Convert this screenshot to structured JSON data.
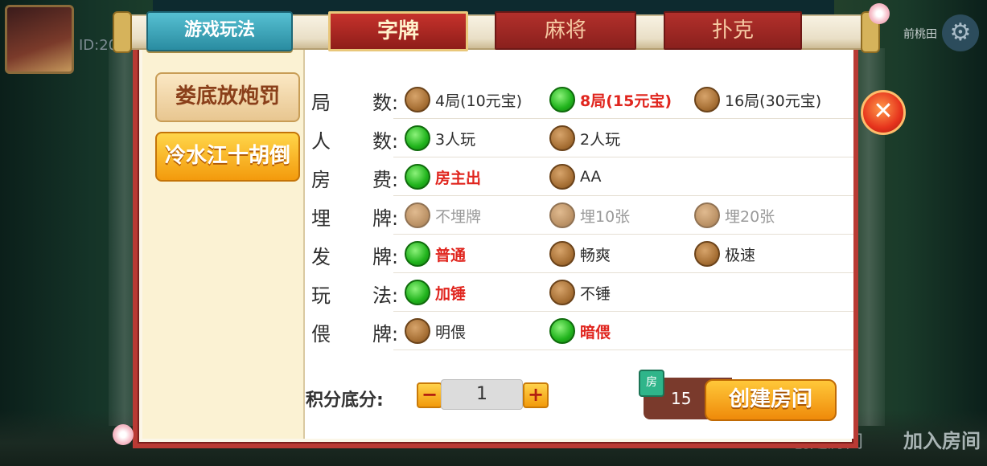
{
  "avatar": {
    "id_label": "ID:20"
  },
  "top_right": {
    "label": "前桃田"
  },
  "tabs": {
    "rules": "游戏玩法",
    "items": [
      {
        "label": "字牌",
        "active": true
      },
      {
        "label": "麻将",
        "active": false
      },
      {
        "label": "扑克",
        "active": false
      }
    ]
  },
  "left_menu": [
    {
      "label": "娄底放炮罚",
      "selected": false
    },
    {
      "label": "冷水江十胡倒",
      "selected": true
    }
  ],
  "rows": [
    {
      "c1": "局",
      "c2": "数:",
      "opts": [
        {
          "text": "4局(10元宝)",
          "selected": false,
          "style": "normal"
        },
        {
          "text": "8局(15元宝)",
          "selected": true,
          "style": "red"
        },
        {
          "text": "16局(30元宝)",
          "selected": false,
          "style": "normal"
        }
      ]
    },
    {
      "c1": "人",
      "c2": "数:",
      "opts": [
        {
          "text": "3人玩",
          "selected": true,
          "style": "normal"
        },
        {
          "text": "2人玩",
          "selected": false,
          "style": "normal"
        }
      ]
    },
    {
      "c1": "房",
      "c2": "费:",
      "opts": [
        {
          "text": "房主出",
          "selected": true,
          "style": "red"
        },
        {
          "text": "AA",
          "selected": false,
          "style": "normal"
        }
      ]
    },
    {
      "c1": "埋",
      "c2": "牌:",
      "opts": [
        {
          "text": "不埋牌",
          "selected": false,
          "style": "gray"
        },
        {
          "text": "埋10张",
          "selected": false,
          "style": "gray"
        },
        {
          "text": "埋20张",
          "selected": false,
          "style": "gray"
        }
      ]
    },
    {
      "c1": "发",
      "c2": "牌:",
      "opts": [
        {
          "text": "普通",
          "selected": true,
          "style": "red"
        },
        {
          "text": "畅爽",
          "selected": false,
          "style": "normal"
        },
        {
          "text": "极速",
          "selected": false,
          "style": "normal"
        }
      ]
    },
    {
      "c1": "玩",
      "c2": "法:",
      "opts": [
        {
          "text": "加锤",
          "selected": true,
          "style": "red"
        },
        {
          "text": "不锤",
          "selected": false,
          "style": "normal"
        }
      ]
    },
    {
      "c1": "偎",
      "c2": "牌:",
      "opts": [
        {
          "text": "明偎",
          "selected": false,
          "style": "normal"
        },
        {
          "text": "暗偎",
          "selected": true,
          "style": "red"
        }
      ]
    }
  ],
  "score": {
    "label": "积分底分:",
    "value": "1",
    "minus": "−",
    "plus": "+"
  },
  "cost": {
    "gem_icon": "房",
    "value": "15"
  },
  "create_button": "创建房间",
  "close_icon": "✕",
  "background": {
    "create_room": "创建房间",
    "join_room": "加入房间"
  },
  "colors": {
    "frame": "#b93a34",
    "selected": "#20b31c",
    "red_text": "#e0251e",
    "button": "#f29a0b"
  }
}
